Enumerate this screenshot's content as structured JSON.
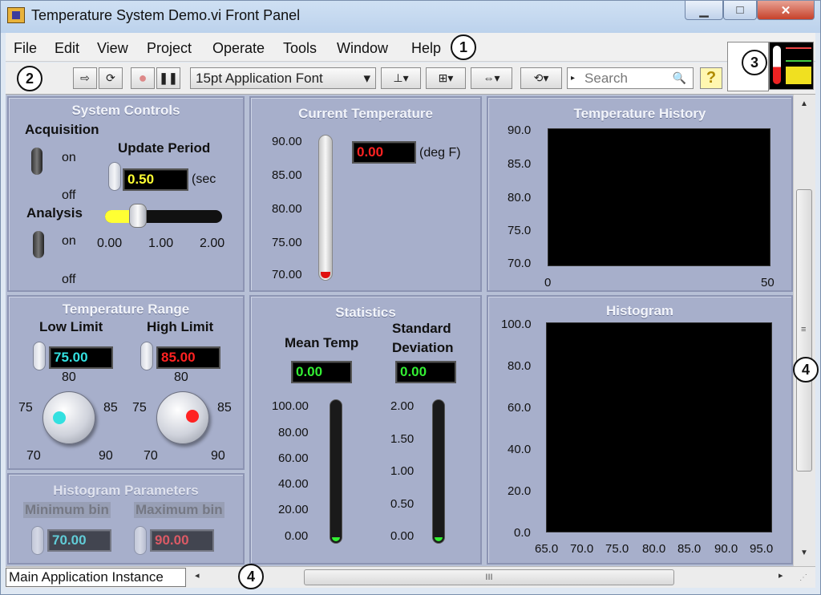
{
  "window": {
    "title": "Temperature System Demo.vi Front Panel"
  },
  "menu": [
    "File",
    "Edit",
    "View",
    "Project",
    "Operate",
    "Tools",
    "Window",
    "Help"
  ],
  "toolbar": {
    "font": "15pt Application Font",
    "search_placeholder": "Search",
    "help": "?"
  },
  "callouts": {
    "c1": "1",
    "c2": "2",
    "c3": "3",
    "c4": "4",
    "c4b": "4"
  },
  "system_controls": {
    "title": "System Controls",
    "acquisition": "Acquisition",
    "on": "on",
    "off": "off",
    "analysis": "Analysis",
    "update_period": "Update Period",
    "update_value": "0.50",
    "update_unit": "(sec",
    "slider_ticks": [
      "0.00",
      "1.00",
      "2.00"
    ],
    "slider_level": 0.25
  },
  "current_temp": {
    "title": "Current Temperature",
    "value": "0.00",
    "unit": "(deg F)",
    "ticks": [
      "90.00",
      "85.00",
      "80.00",
      "75.00",
      "70.00"
    ]
  },
  "temp_history": {
    "title": "Temperature History",
    "yticks": [
      "90.0",
      "85.0",
      "80.0",
      "75.0",
      "70.0"
    ],
    "xticks": [
      "0",
      "50"
    ]
  },
  "temp_range": {
    "title": "Temperature Range",
    "low_label": "Low Limit",
    "low_value": "75.00",
    "high_label": "High Limit",
    "high_value": "85.00",
    "knob_labels": [
      "75",
      "80",
      "85",
      "70",
      "90"
    ]
  },
  "statistics": {
    "title": "Statistics",
    "mean_label": "Mean Temp",
    "mean_value": "0.00",
    "std_label1": "Standard",
    "std_label2": "Deviation",
    "std_value": "0.00",
    "mean_ticks": [
      "100.00",
      "80.00",
      "60.00",
      "40.00",
      "20.00",
      "0.00"
    ],
    "std_ticks": [
      "2.00",
      "1.50",
      "1.00",
      "0.50",
      "0.00"
    ]
  },
  "histogram": {
    "title": "Histogram",
    "yticks": [
      "100.0",
      "80.0",
      "60.0",
      "40.0",
      "20.0",
      "0.0"
    ],
    "xticks": [
      "65.0",
      "70.0",
      "75.0",
      "80.0",
      "85.0",
      "90.0",
      "95.0"
    ]
  },
  "hist_params": {
    "title": "Histogram Parameters",
    "min_label": "Minimum bin",
    "min_value": "70.00",
    "max_label": "Maximum bin",
    "max_value": "90.00"
  },
  "status": {
    "instance": "Main Application Instance",
    "scroll_mark": "III"
  },
  "colors": {
    "yellow": "#ffff33",
    "cyan": "#33e0e0",
    "red": "#ff2222",
    "green": "#33ee33"
  }
}
